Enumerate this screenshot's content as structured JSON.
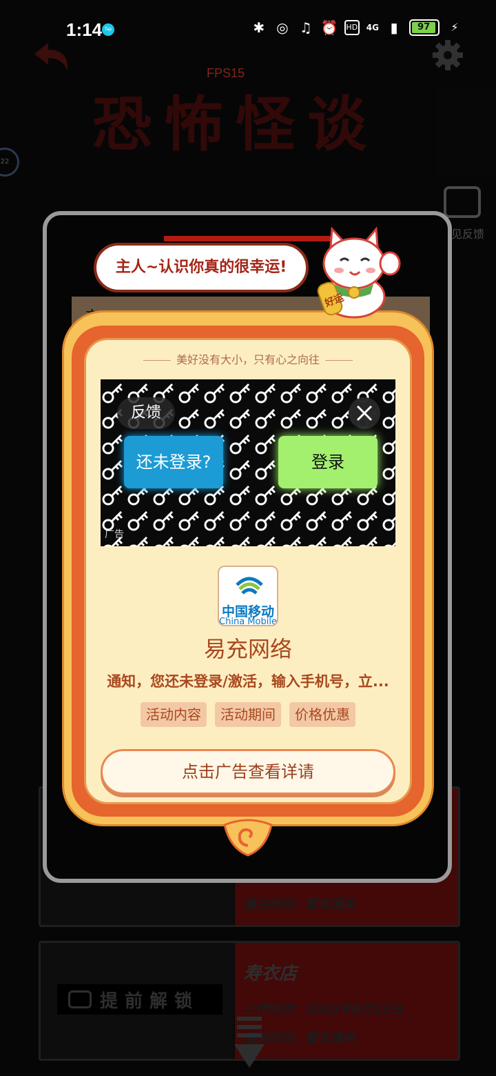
{
  "status_bar": {
    "time": "1:14",
    "tap_badge": "Tap",
    "network": "4G",
    "battery": "97"
  },
  "background": {
    "fps": "FPS15",
    "title": "恐怖怪谈",
    "side_circle": "22",
    "feedback_label": "意见反馈",
    "card1": {
      "clear_time": "通关时间：暂未通关"
    },
    "card2": {
      "name": "寿衣店",
      "upload_time": "上传时间：2023年8月13日",
      "clear_time": "通关时间：暂未通关",
      "unlock_label": "提前解锁"
    },
    "paper_fragment": "亲"
  },
  "dialog": {
    "speech": "主人~认识你真的很幸运!",
    "cat_charm": "好运",
    "tagline": "美好没有大小，只有心之向往",
    "ad": {
      "feedback": "反馈",
      "not_logged_button": "还未登录?",
      "login_button": "登录",
      "ad_mark": "广告",
      "app_icon_text": "中国移动",
      "app_icon_subtext": "China Mobile",
      "app_name": "易充网络",
      "description": "通知，您还未登录/激活，输入手机号，立...",
      "tags": [
        "活动内容",
        "活动期间",
        "价格优惠"
      ],
      "cta": "点击广告查看详请"
    }
  },
  "colors": {
    "accent_orange": "#e6642e",
    "gold": "#f7c25a",
    "cream": "#fdeec2",
    "text_brown": "#a9481e",
    "login_green": "#a2f06e",
    "not_logged_blue": "#1c9bd4"
  }
}
